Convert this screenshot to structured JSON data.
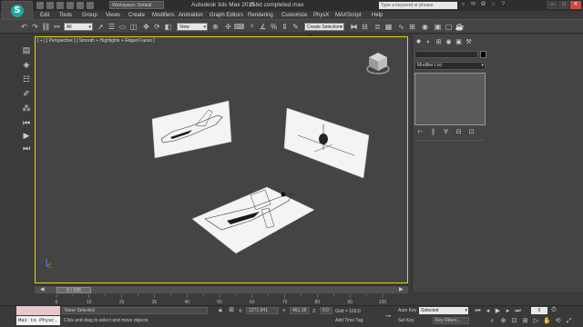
{
  "titlebar": {
    "app_title": "Autodesk 3ds Max 2015",
    "file_name": "f16d completed.max",
    "workspace": "Workspace: Default",
    "search_placeholder": "Type a keyword or phrase"
  },
  "menu": [
    "Edit",
    "Tools",
    "Group",
    "Views",
    "Create",
    "Modifiers",
    "Animation",
    "Graph Editors",
    "Rendering",
    "Customize",
    "PhysX",
    "MAXScript",
    "Help"
  ],
  "toolbar": {
    "filter_value": "All",
    "ref_coord_value": "View",
    "selection_set_placeholder": "Create Selection Se"
  },
  "viewport": {
    "label": "[ + ] [ Perspective ] [ Smooth + Highlights + Edged Faces ]",
    "background": "#444444",
    "border_color": "#e5d400"
  },
  "command_panel": {
    "modifier_list": "Modifier List"
  },
  "timeline": {
    "frame_indicator": "0 / 100",
    "ticks": [
      "0",
      "10",
      "20",
      "30",
      "40",
      "50",
      "60",
      "70",
      "80",
      "90",
      "100"
    ]
  },
  "status": {
    "maxscript_text": "Max to Physc.",
    "selection_status": "None Selected",
    "prompt": "Click and drag to select and move objects",
    "x_label": "X:",
    "x_value": "1271.941",
    "y_label": "Y:",
    "y_value": "461.18",
    "z_label": "Z:",
    "z_value": "0.0",
    "grid": "Grid = 100.0",
    "add_time_tag": "Add Time Tag",
    "auto_key": "Auto Key",
    "set_key": "Set Key",
    "selected_option": "Selected",
    "key_filters": "Key Filters...",
    "current_frame": "0"
  }
}
